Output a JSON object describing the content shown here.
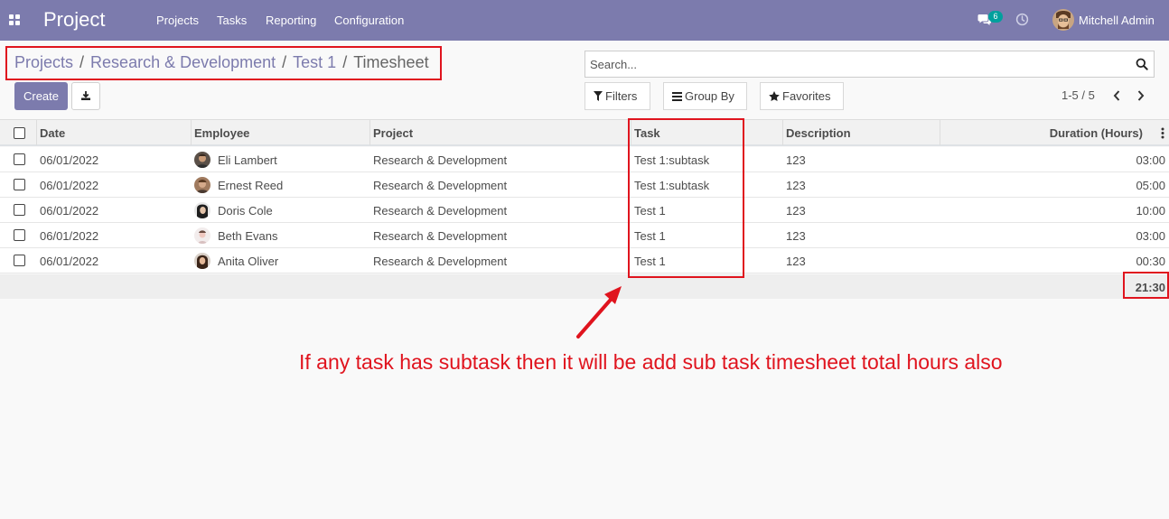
{
  "navbar": {
    "app_title": "Project",
    "menu": [
      "Projects",
      "Tasks",
      "Reporting",
      "Configuration"
    ],
    "messages_count": "6",
    "user_name": "Mitchell Admin",
    "icons": [
      "apps-icon",
      "chat-icon",
      "clock-icon"
    ]
  },
  "breadcrumb": {
    "items": [
      "Projects",
      "Research & Development",
      "Test 1"
    ],
    "separator": "/",
    "current": "Timesheet"
  },
  "buttons": {
    "create": "Create",
    "download_icon": "download-icon"
  },
  "search": {
    "placeholder": "Search..."
  },
  "filters": {
    "filters_label": "Filters",
    "group_by_label": "Group By",
    "favorites_label": "Favorites"
  },
  "pager": {
    "value": "1-5 / 5"
  },
  "table": {
    "columns": [
      "Date",
      "Employee",
      "Project",
      "Task",
      "Description",
      "Duration (Hours)"
    ],
    "rows": [
      {
        "date": "06/01/2022",
        "employee": "Eli Lambert",
        "project": "Research & Development",
        "task": "Test 1:subtask",
        "description": "123",
        "duration": "03:00"
      },
      {
        "date": "06/01/2022",
        "employee": "Ernest Reed",
        "project": "Research & Development",
        "task": "Test 1:subtask",
        "description": "123",
        "duration": "05:00"
      },
      {
        "date": "06/01/2022",
        "employee": "Doris Cole",
        "project": "Research & Development",
        "task": "Test 1",
        "description": "123",
        "duration": "10:00"
      },
      {
        "date": "06/01/2022",
        "employee": "Beth Evans",
        "project": "Research & Development",
        "task": "Test 1",
        "description": "123",
        "duration": "03:00"
      },
      {
        "date": "06/01/2022",
        "employee": "Anita Oliver",
        "project": "Research & Development",
        "task": "Test 1",
        "description": "123",
        "duration": "00:30"
      }
    ],
    "total_duration": "21:30"
  },
  "annotation": {
    "text": "If any task has subtask then it will be add sub task timesheet total hours also",
    "color": "#e0141e"
  },
  "colors": {
    "brand": "#7c7bad",
    "annotation_red": "#e0141e",
    "badge": "#00a09d"
  }
}
